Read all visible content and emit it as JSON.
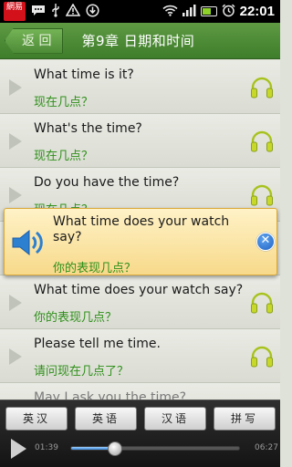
{
  "status_bar": {
    "app_badge": "網易",
    "time": "22:01",
    "battery_level": 0.7,
    "icons": [
      "netease-app-icon",
      "chat-icon",
      "usb-icon",
      "warning-icon",
      "download-icon",
      "wifi-icon",
      "signal-icon",
      "battery-charging-icon",
      "alarm-icon"
    ]
  },
  "header": {
    "back_label": "返 回",
    "title": "第9章 日期和时间"
  },
  "phrases": [
    {
      "en": "What time is it?",
      "cn": "现在几点？"
    },
    {
      "en": "What's the time?",
      "cn": "现在几点？"
    },
    {
      "en": "Do you have the time?",
      "cn": "现在几点？"
    },
    {
      "en": "",
      "cn": ""
    },
    {
      "en": "What time does your watch say?",
      "cn": "你的表现几点？"
    },
    {
      "en": "Please tell me time.",
      "cn": "请问现在几点了？"
    },
    {
      "en": "May I ask you the time?",
      "cn": ""
    }
  ],
  "popup": {
    "en": "What time does your watch say?",
    "cn": "你的表现几点？"
  },
  "mode_buttons": [
    "英汉",
    "英语",
    "汉语",
    "拼写"
  ],
  "player": {
    "elapsed": "01:39",
    "total": "06:27",
    "progress": 0.26
  },
  "colors": {
    "header_green": "#4d8c36",
    "chinese_text": "#2f8f1a",
    "popup_bg": "#f7d98a",
    "progress": "#3a86d6"
  }
}
